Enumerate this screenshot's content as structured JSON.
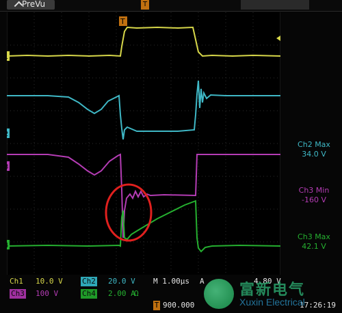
{
  "status": {
    "label": "PreVu"
  },
  "trigger_marker": "T",
  "right_labels": {
    "ch2": {
      "title": "Ch2 Max",
      "value": "34.0 V"
    },
    "ch3": {
      "title": "Ch3 Min",
      "value": "-160 V"
    },
    "ch4": {
      "title": "Ch3 Max",
      "value": "42.1 V"
    }
  },
  "readout": {
    "ch1_name": "Ch1",
    "ch1_scale": "10.0 V",
    "ch2_name": "Ch2",
    "ch2_scale": "20.0 V",
    "ch3_name": "Ch3",
    "ch3_scale": "100 V",
    "ch4_name": "Ch4",
    "ch4_scale": "2.00 A",
    "ch4_unit": "Ω",
    "timebase": "M 1.00µs",
    "trigger_source": "A",
    "trigger_level": "4.80 V",
    "trigger_position": "900.000",
    "time": "17:26:19"
  },
  "channel_markers": [
    "1",
    "2",
    "3",
    "4"
  ],
  "colors": {
    "ch1": "#d8d84a",
    "ch2": "#3fb8c6",
    "ch3": "#b43cb4",
    "ch4": "#25b030",
    "highlight": "#e0201e",
    "grid": "#2b2b2b"
  },
  "watermark": {
    "cn": "富新电气",
    "en": "Xuxin Electrical"
  }
}
